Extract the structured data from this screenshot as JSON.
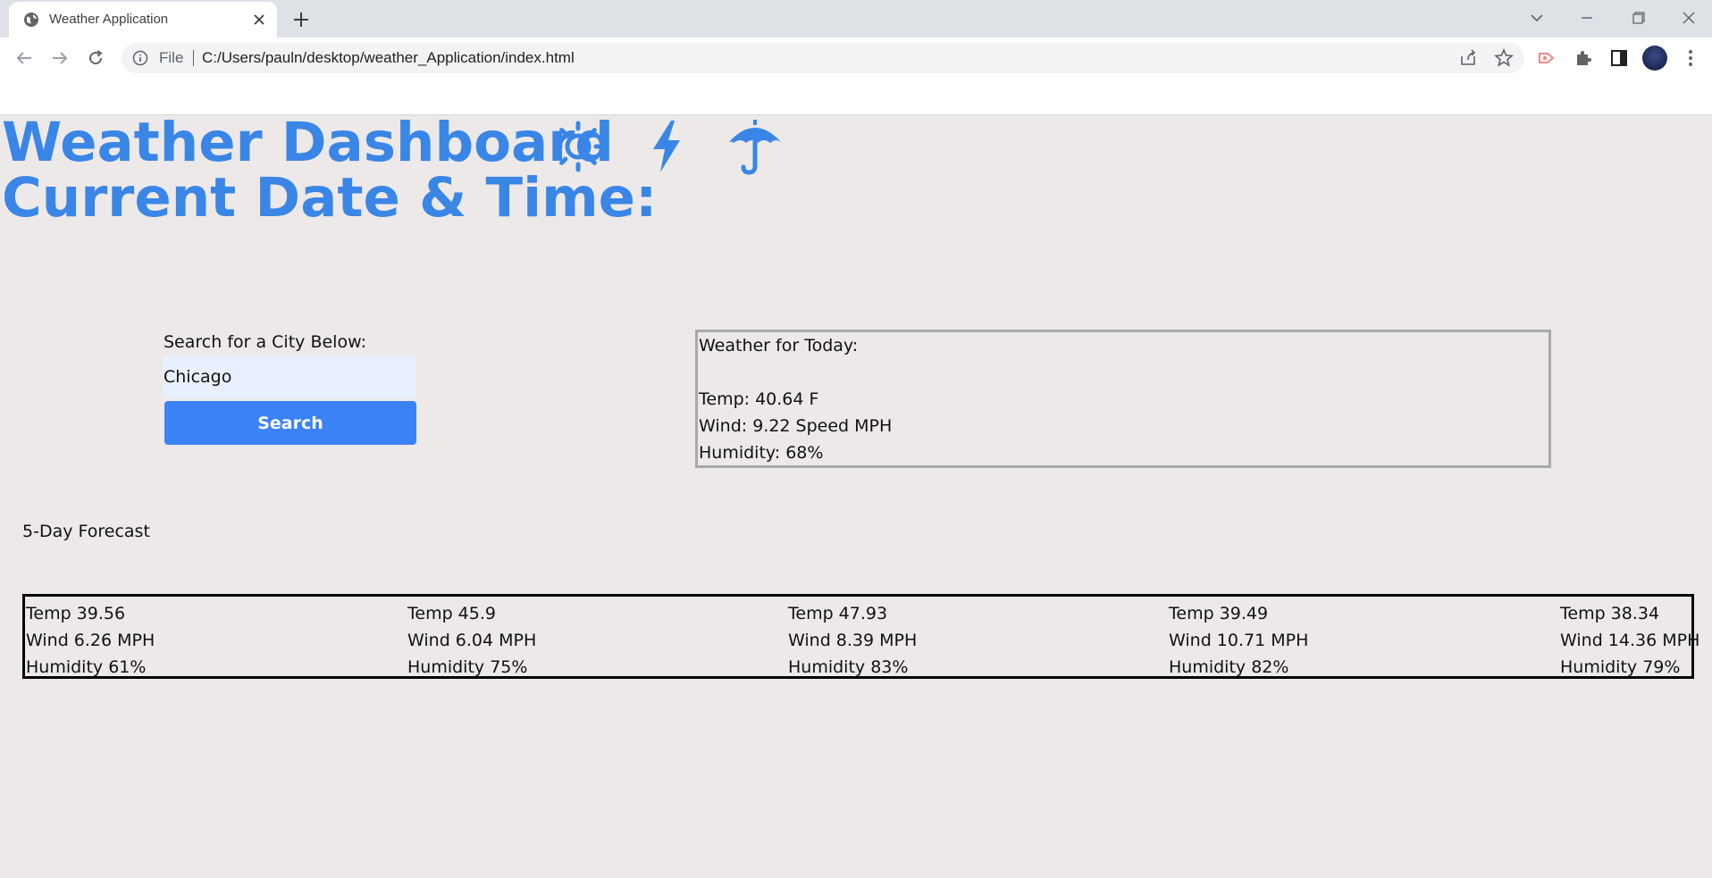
{
  "browser": {
    "tab_title": "Weather Application",
    "omnibox_file": "File",
    "url": "C:/Users/pauln/desktop/weather_Application/index.html"
  },
  "page": {
    "title": "Weather Dashboard",
    "subtitle": "Current Date & Time:",
    "accent_color": "#3a86e6",
    "icons": [
      "sun-icon",
      "lightning-icon",
      "umbrella-icon"
    ]
  },
  "search": {
    "label": "Search for a City Below:",
    "value": "Chicago",
    "button_label": "Search"
  },
  "today": {
    "heading": "Weather for Today:",
    "temp": "Temp: 40.64 F",
    "wind": "Wind: 9.22 Speed MPH",
    "humidity": "Humidity: 68%"
  },
  "forecast": {
    "label": "5-Day Forecast",
    "days": [
      {
        "temp": "Temp 39.56",
        "wind": "Wind 6.26 MPH",
        "humidity": "Humidity 61%"
      },
      {
        "temp": "Temp 45.9",
        "wind": "Wind 6.04 MPH",
        "humidity": "Humidity 75%"
      },
      {
        "temp": "Temp 47.93",
        "wind": "Wind 8.39 MPH",
        "humidity": "Humidity 83%"
      },
      {
        "temp": "Temp 39.49",
        "wind": "Wind 10.71 MPH",
        "humidity": "Humidity 82%"
      },
      {
        "temp": "Temp 38.34",
        "wind": "Wind 14.36 MPH",
        "humidity": "Humidity 79%"
      }
    ]
  }
}
